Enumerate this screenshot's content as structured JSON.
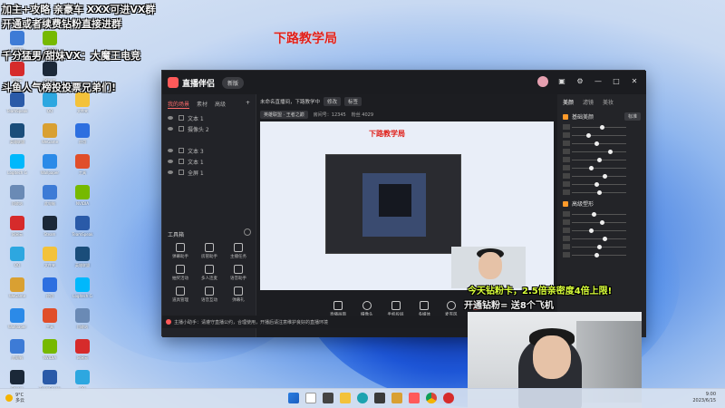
{
  "overlay": {
    "top_left_line1": "加主+攻略 亲豪车 XXX可进VX群",
    "top_left_line2": "开通或者续费钻粉直接进群",
    "top_left_line3": "千分猛男/甜妹VX：大魔王电竞",
    "top_left_line4": "斗鱼人气榜投投票兄弟们!",
    "center_red_title": "下路教学局",
    "bottom_line1": "今天钻粉卡，2.5倍亲密度4倍上限!",
    "bottom_line2": "开通钻粉= 送8个飞机"
  },
  "desktop_icons": [
    {
      "label": "此电脑",
      "color": "#3d7bd6"
    },
    {
      "label": "NVIDIA",
      "color": "#76b900"
    },
    {
      "label": "网易云",
      "color": "#d62b2b"
    },
    {
      "label": "Steam",
      "color": "#1b2838"
    },
    {
      "label": "TeamSpeak",
      "color": "#2a5aa8"
    },
    {
      "label": "QQ",
      "color": "#2da7e0"
    },
    {
      "label": "文件夹",
      "color": "#f3c23a"
    },
    {
      "label": "英雄联盟",
      "color": "#1a4d7a"
    },
    {
      "label": "WeGame",
      "color": "#d9a032"
    },
    {
      "label": "应用",
      "color": "#2d6fe0"
    },
    {
      "label": "Logitech G",
      "color": "#00b8fc"
    },
    {
      "label": "Wallpaper",
      "color": "#2b8ae8"
    },
    {
      "label": "工具",
      "color": "#e04e2a"
    },
    {
      "label": "回收站",
      "color": "#6a8ab5"
    }
  ],
  "app": {
    "logo_text": "直播伴侣",
    "version_button": "新版",
    "left_tabs": [
      "我的场景",
      "素材",
      "高级"
    ],
    "scenes": [
      "文本 1",
      "摄像头 2",
      "文本 3",
      "文本 1",
      "全屏 1"
    ],
    "tools_title": "工具箱",
    "tools": [
      "弹幕助手",
      "房管助手",
      "主播任务",
      "抽奖活动",
      "多人连麦",
      "语音助手",
      "道具管理",
      "语音互动",
      "弹幕礼"
    ],
    "room_title": "未命名直播间，下路教学中",
    "room_buttons": [
      "修改",
      "标签"
    ],
    "room_meta": [
      "英雄联盟 · 王者之巅",
      "房间号：12345",
      "粉丝 4029"
    ],
    "bottom_buttons": [
      "直播画面",
      "摄像头",
      "手机投屏",
      "多媒体",
      "麦克风",
      "扬声器"
    ],
    "notice": "主播小助手：请遵守直播公约，合理使用，开播后请注意维护良好的直播环境"
  },
  "right_panel": {
    "tabs": [
      "美颜",
      "滤镜",
      "美妆"
    ],
    "section1_label": "基础美颜",
    "section1_select": "标准",
    "section2_label": "高级塑形",
    "section1_slider_levels": [
      0.55,
      0.3,
      0.45,
      0.7,
      0.5,
      0.35,
      0.6,
      0.45,
      0.5
    ],
    "section2_slider_levels": [
      0.4,
      0.55,
      0.35,
      0.6,
      0.5,
      0.45
    ]
  },
  "taskbar": {
    "weather_temp": "9°C",
    "weather_desc": "多云",
    "time": "9:00",
    "date": "2023/6/15"
  }
}
